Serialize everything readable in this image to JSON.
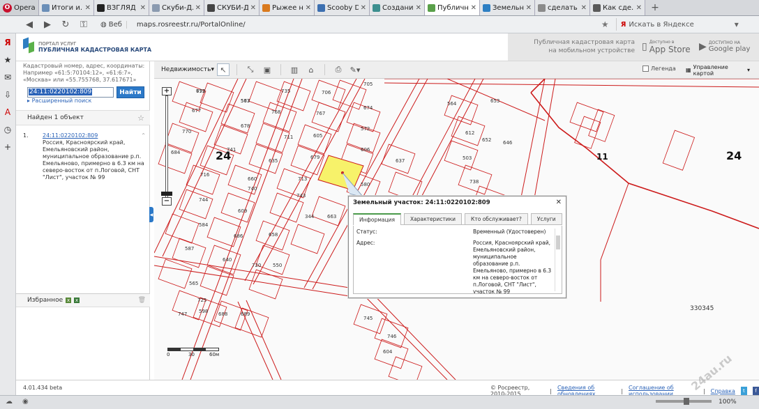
{
  "browser": {
    "menu_label": "Opera",
    "tabs": [
      {
        "label": "Итоги и...",
        "color": "#6b8fb8",
        "active": false
      },
      {
        "label": "ВЗГЛЯД",
        "color": "#222222",
        "active": false
      },
      {
        "label": "Скуби-Д...",
        "color": "#8b9bb0",
        "active": false
      },
      {
        "label": "СКУБИ-Д...",
        "color": "#444444",
        "active": false
      },
      {
        "label": "Рыжее н...",
        "color": "#d97a1e",
        "active": false
      },
      {
        "label": "Scooby D...",
        "color": "#3c6fb0",
        "active": false
      },
      {
        "label": "Создани...",
        "color": "#3c8f8f",
        "active": false
      },
      {
        "label": "Публичн...",
        "color": "#5aa04a",
        "active": true
      },
      {
        "label": "Земельн...",
        "color": "#2d7fc3",
        "active": false
      },
      {
        "label": "сделать с...",
        "color": "#8b8b8b",
        "active": false
      },
      {
        "label": "Как сде...",
        "color": "#5a5a5a",
        "active": false
      }
    ],
    "security_label": "Веб",
    "url": "maps.rosreestr.ru/PortalOnline/",
    "search_placeholder": "Искать в Яндексе",
    "yandex_letter": "Я"
  },
  "site": {
    "logo_small": "ПОРТАЛ УСЛУГ",
    "logo_big": "ПУБЛИЧНАЯ КАДАСТРОВАЯ КАРТА",
    "mobile_line1": "Публичная кадастровая карта",
    "mobile_line2": "на мобильном устройстве",
    "appstore_small": "Доступно в",
    "appstore_big": "App Store",
    "gp_small": "ДОСТУПНО НА",
    "gp_big": "Google play"
  },
  "left_panel": {
    "search_hint": "Кадастровый номер, адрес, координаты: Например «61:5:70104:12», «61:6:7», «Москва» или «55.755768, 37.617671»",
    "input_value": "24:11:0220102:809",
    "find_label": "Найти",
    "advanced_label": "Расширенный поиск",
    "found_label": "Найден 1 объект",
    "result_number": "1.",
    "result_link": "24:11:0220102:809",
    "result_address": "Россия, Красноярский край, Емельяновский район, муниципальное образование р.п. Емельяново, примерно в 6.3 км на северо-восток от п.Логовой, СНТ \"Лист\", участок № 99",
    "favorites_label": "Избранное"
  },
  "toolbar": {
    "layer_label": "Недвижимость",
    "legend_label": "Легенда",
    "map_control_label": "Управление картой"
  },
  "map": {
    "district_labels": [
      "24",
      "11",
      "24"
    ],
    "area_code": "330345",
    "parcels": [
      "659",
      "577",
      "735",
      "706",
      "705",
      "677",
      "768",
      "767",
      "674",
      "564",
      "653",
      "770",
      "678",
      "711",
      "605",
      "572",
      "612",
      "652",
      "684",
      "741",
      "635",
      "679",
      "606",
      "637",
      "503",
      "716",
      "660",
      "713",
      "580",
      "738",
      "744",
      "740",
      "743",
      "609",
      "584",
      "686",
      "658",
      "587",
      "640",
      "720",
      "565",
      "725",
      "598",
      "747",
      "688",
      "689",
      "745",
      "746",
      "604",
      "558",
      "559",
      "646",
      "550",
      "344",
      "663",
      "772",
      "563"
    ],
    "scale_labels": [
      "0",
      "30",
      "60м"
    ]
  },
  "popup": {
    "title": "Земельный участок: 24:11:0220102:809",
    "tabs": [
      "Информация",
      "Характеристики",
      "Кто обслуживает?",
      "Услуги"
    ],
    "status_label": "Статус:",
    "status_value": "Временный (Удостоверен)",
    "address_label": "Адрес:",
    "address_value": "Россия, Красноярский край, Емельяновский район, муниципальное образование р.п. Емельяново, примерно в 6.3 км на северо-восток от п.Логовой, СНТ \"Лист\", участок № 99"
  },
  "footer": {
    "version": "4.01.434 beta",
    "copyright": "© Росреестр, 2010-2015",
    "link_updates": "Сведения об обновлениях",
    "link_agreement": "Соглашение об использовании",
    "link_help": "Справка"
  },
  "status": {
    "zoom_pct": "100%"
  },
  "watermark": "24au.ru",
  "colors": {
    "accent": "#2c79c8",
    "parcel_line": "#cc1a1a",
    "selected_fill": "#f7f26a",
    "active_tab": "#4a9a4a"
  }
}
